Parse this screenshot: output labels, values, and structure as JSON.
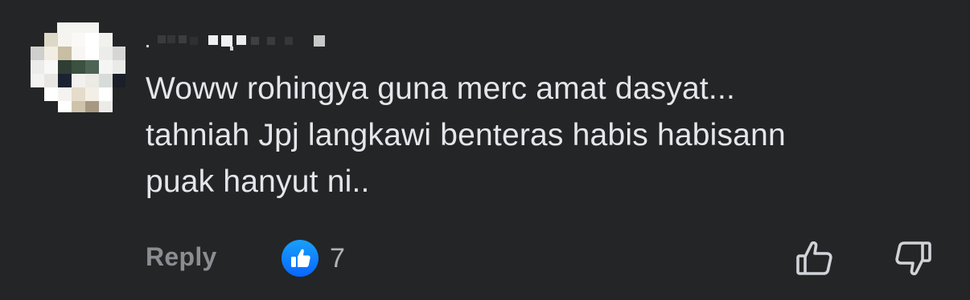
{
  "comment": {
    "author_name": "",
    "text": "Woww rohingya guna merc amat dasyat...\ntahniah Jpj langkawi benteras habis habisann\npuak hanyut ni..",
    "reply_label": "Reply",
    "reaction_count": "7",
    "reaction_icon": "thumbs-up-icon",
    "upvote_icon": "thumbs-up-outline-icon",
    "downvote_icon": "thumbs-down-outline-icon"
  },
  "colors": {
    "background": "#242526",
    "text_primary": "#e4e6eb",
    "text_secondary": "#8a8d91",
    "like_blue": "#2e89ff"
  }
}
